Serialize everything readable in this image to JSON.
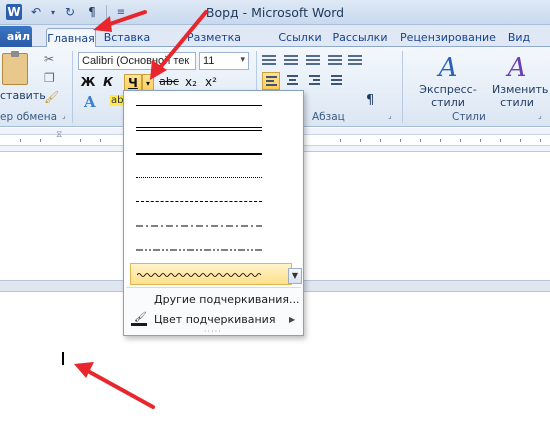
{
  "window": {
    "title": "Ворд - Microsoft Word"
  },
  "quick_access": {
    "items": [
      "word-icon",
      "undo-icon",
      "redo-icon",
      "paragraph-mark-icon",
      "customize-icon"
    ]
  },
  "tabs": {
    "file": "айл",
    "home": "Главная",
    "insert": "Вставка",
    "page_layout": "Разметка страницы",
    "references": "Ссылки",
    "mailings": "Рассылки",
    "review": "Рецензирование",
    "view": "Вид"
  },
  "ribbon": {
    "clipboard": {
      "paste_label": "ставить",
      "group_label": "ер обмена"
    },
    "font": {
      "font_name": "Calibri (Основной тек",
      "font_size": "11",
      "bold": "Ж",
      "italic": "К",
      "underline": "Ч",
      "strike": "abc",
      "subscript": "x₂",
      "superscript": "x²"
    },
    "paragraph": {
      "group_label": "Абзац",
      "pilcrow": "¶"
    },
    "styles": {
      "group_label": "Стили",
      "express_styles": "Экспресс-стили",
      "change_styles_line1": "Изменить",
      "change_styles_line2": "стили"
    }
  },
  "underline_menu": {
    "styles": [
      "single",
      "double",
      "thick",
      "dotted",
      "dashed",
      "dash-dot",
      "dash-dot-dot",
      "wave"
    ],
    "selected_index": 7,
    "more_underlines": "Другие подчеркивания...",
    "underline_color": "Цвет подчеркивания"
  },
  "colors": {
    "accent_blue": "#2a5ba8",
    "highlight_yellow": "#ffd966",
    "arrow_red": "#e8262b"
  }
}
